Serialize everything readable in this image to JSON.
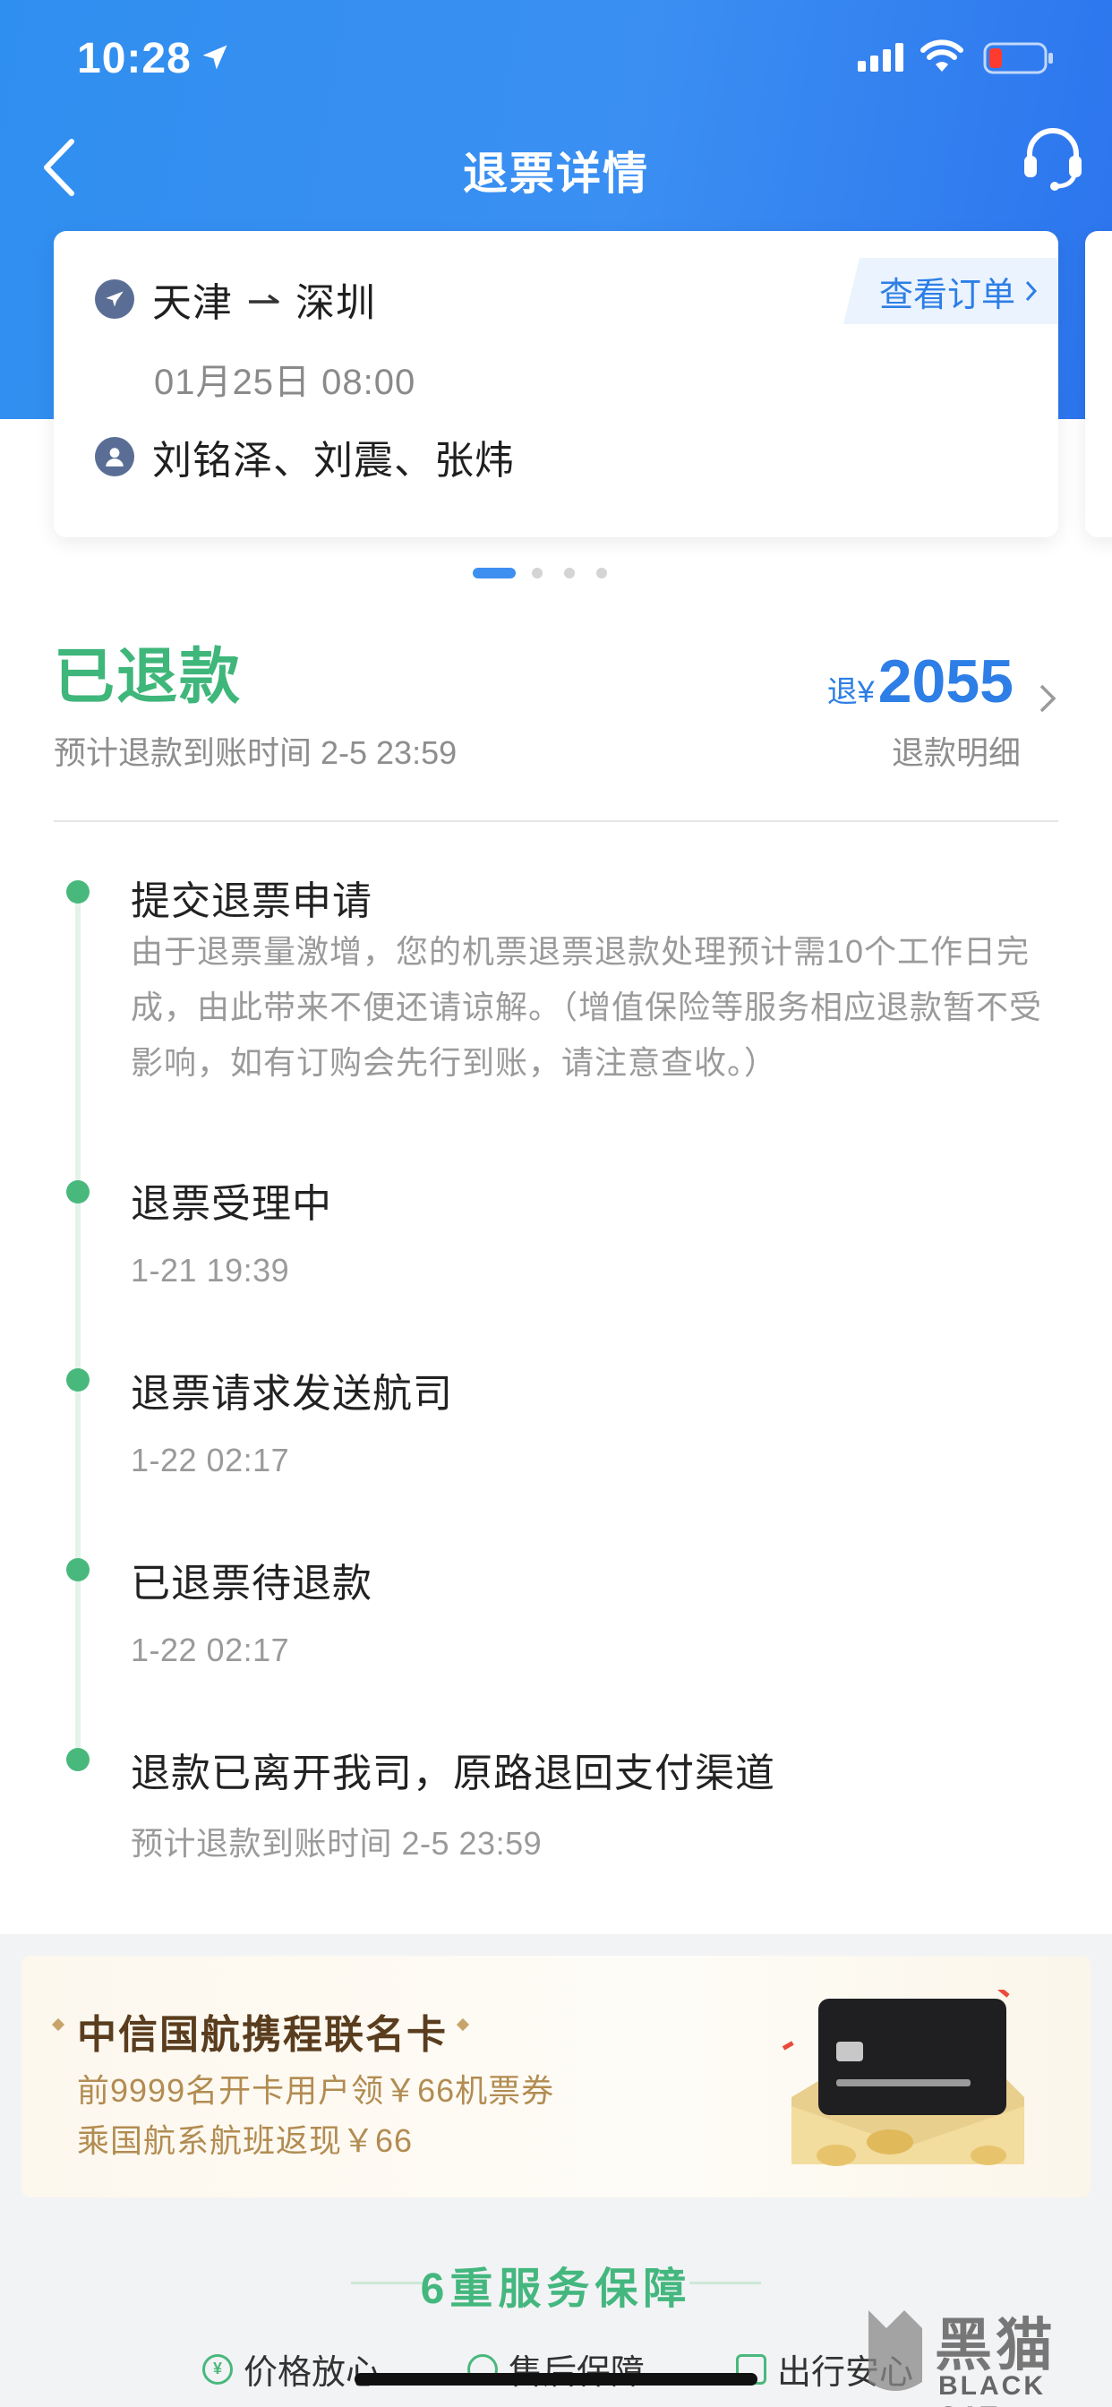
{
  "status_bar": {
    "time": "10:28"
  },
  "nav": {
    "title": "退票详情"
  },
  "trip": {
    "from": "天津",
    "to": "深圳",
    "datetime": "01月25日 08:00",
    "passengers": "刘铭泽、刘震、张炜",
    "view_order_label": "查看订单"
  },
  "carousel": {
    "count": 4,
    "active": 0
  },
  "refund": {
    "status": "已退款",
    "eta": "预计退款到账时间 2-5 23:59",
    "amount_prefix": "退¥",
    "amount": "2055",
    "detail_label": "退款明细"
  },
  "timeline": [
    {
      "title": "提交退票申请",
      "desc": "由于退票量激增，您的机票退票退款处理预计需10个工作日完成，由此带来不便还请谅解。（增值保险等服务相应退款暂不受影响，如有订购会先行到账，请注意查收。）"
    },
    {
      "title": "退票受理中",
      "sub": "1-21 19:39"
    },
    {
      "title": "退票请求发送航司",
      "sub": "1-22 02:17"
    },
    {
      "title": "已退票待退款",
      "sub": "1-22 02:17"
    },
    {
      "title": "退款已离开我司，原路退回支付渠道",
      "sub": "预计退款到账时间 2-5 23:59"
    }
  ],
  "promo": {
    "title": "中信国航携程联名卡",
    "line1": "前9999名开卡用户领￥66机票券",
    "line2": "乘国航系航班返现￥66"
  },
  "services": {
    "title": "6重服务保障",
    "items": [
      "价格放心",
      "售后保障",
      "出行安心"
    ]
  },
  "watermark": {
    "cn": "黑猫",
    "en": "BLACK CAT"
  },
  "colors": {
    "brand_blue": "#2f8ff0",
    "success_green": "#3fb67a",
    "link_blue": "#2d7ee6"
  }
}
